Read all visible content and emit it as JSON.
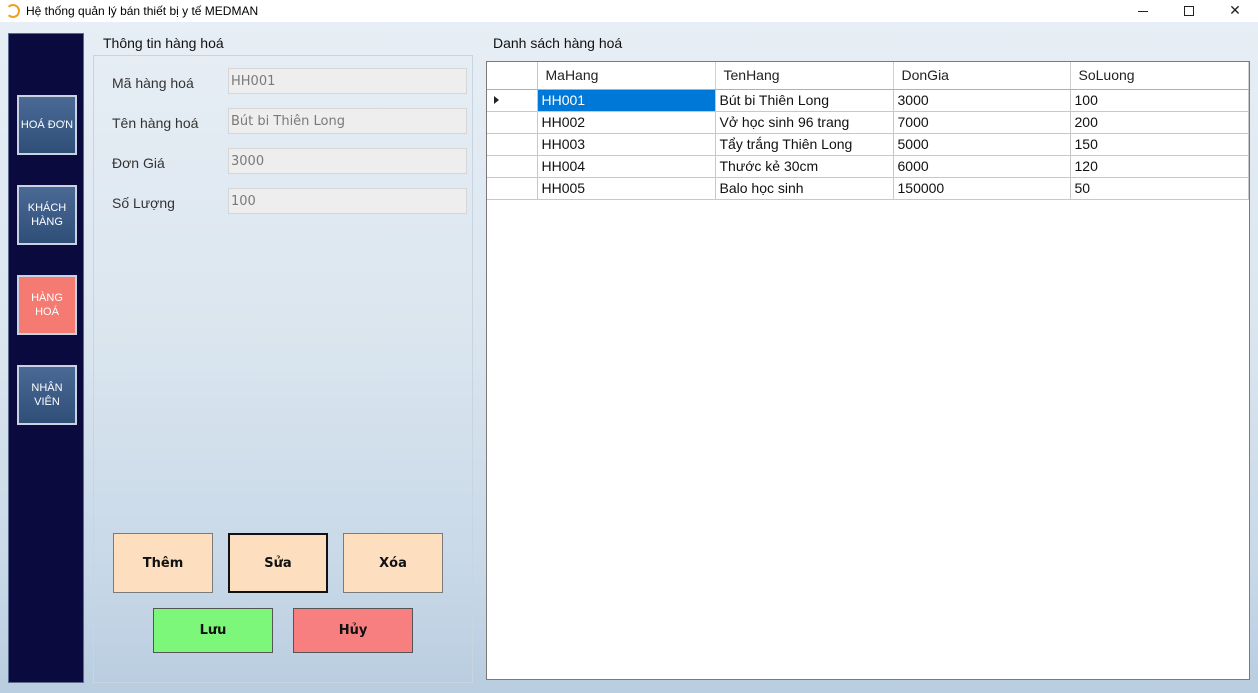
{
  "window": {
    "title": "Hệ thống quản lý bán thiết bị y tế MEDMAN"
  },
  "sidebar": {
    "items": [
      {
        "label": "HOÁ ĐƠN",
        "active": false
      },
      {
        "label": "KHÁCH HÀNG",
        "active": false
      },
      {
        "label": "HÀNG HOÁ",
        "active": true
      },
      {
        "label": "NHÂN VIÊN",
        "active": false
      }
    ]
  },
  "info": {
    "title": "Thông tin hàng hoá",
    "fields": [
      {
        "label": "Mã hàng hoá",
        "value": "HH001"
      },
      {
        "label": "Tên hàng hoá",
        "value": "Bút bi Thiên Long"
      },
      {
        "label": "Đơn Giá",
        "value": "3000"
      },
      {
        "label": "Số Lượng",
        "value": "100"
      }
    ]
  },
  "actions": {
    "add": "Thêm",
    "edit": "Sửa",
    "delete": "Xóa",
    "save": "Lưu",
    "cancel": "Hủy"
  },
  "list": {
    "title": "Danh sách hàng hoá",
    "columns": [
      "MaHang",
      "TenHang",
      "DonGia",
      "SoLuong"
    ],
    "rows": [
      [
        "HH001",
        "Bút bi Thiên Long",
        "3000",
        "100"
      ],
      [
        "HH002",
        "Vở học sinh 96 trang",
        "7000",
        "200"
      ],
      [
        "HH003",
        "Tẩy trắng Thiên Long",
        "5000",
        "150"
      ],
      [
        "HH004",
        "Thước kẻ 30cm",
        "6000",
        "120"
      ],
      [
        "HH005",
        "Balo học sinh",
        "150000",
        "50"
      ]
    ]
  },
  "colors": {
    "sidebar_bg": "#0a0a3e",
    "active_item": "#f47a72",
    "selected_cell": "#0078d7",
    "button_peach": "#fddfc0",
    "button_green": "#7cf77a",
    "button_red": "#f87f7f"
  }
}
